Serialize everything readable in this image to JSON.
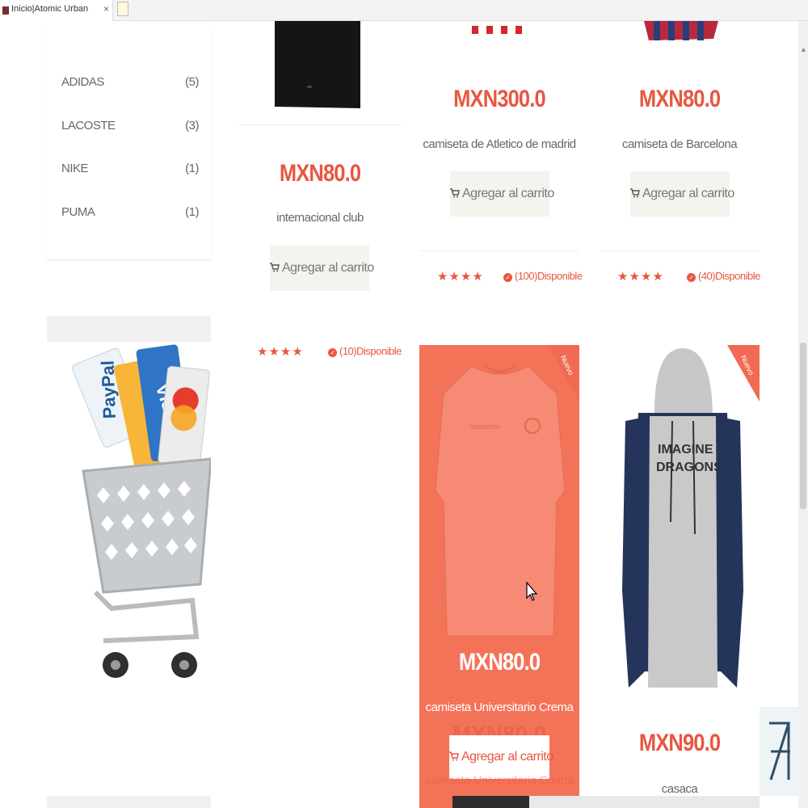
{
  "browser": {
    "tab_title": "Inicio|Atomic Urban",
    "tab_close": "×"
  },
  "sidebar": {
    "brands": [
      {
        "name": "ADIDAS",
        "count": "(5)"
      },
      {
        "name": "LACOSTE",
        "count": "(3)"
      },
      {
        "name": "NIKE",
        "count": "(1)"
      },
      {
        "name": "PUMA",
        "count": "(1)"
      }
    ]
  },
  "products": {
    "international": {
      "price": "MXN80.0",
      "name": "internacional club",
      "button": "Agregar al carrito",
      "rating": 4,
      "stock": "(10)Disponible"
    },
    "atletico": {
      "price": "MXN300.0",
      "name": "camiseta de Atletico de madrid",
      "button": "Agregar al carrito",
      "rating": 4,
      "stock": "(100)Disponible"
    },
    "barcelona": {
      "price": "MXN80.0",
      "name": "camiseta de Barcelona",
      "button": "Agregar al carrito",
      "rating": 4,
      "stock": "(40)Disponible"
    },
    "universitario": {
      "price": "MXN80.0",
      "name": "camiseta Universitario Crema",
      "button": "Agregar al carrito",
      "badge": "Nuevo",
      "ghost_price": "MXN80.0",
      "ghost_name": "camiseta Universitario Crema"
    },
    "casaca": {
      "price": "MXN90.0",
      "name": "casaca",
      "badge": "Nuevo",
      "hoodie_print_line1": "IMAGINE",
      "hoodie_print_line2": "DRAGONS"
    }
  },
  "colors": {
    "accent": "#e8573f",
    "hover_overlay": "#f37359",
    "button_bg": "#f5f3ee"
  },
  "icons": [
    "cart-icon",
    "check-circle-icon",
    "star-icon",
    "close-icon",
    "mouse-cursor-icon"
  ]
}
